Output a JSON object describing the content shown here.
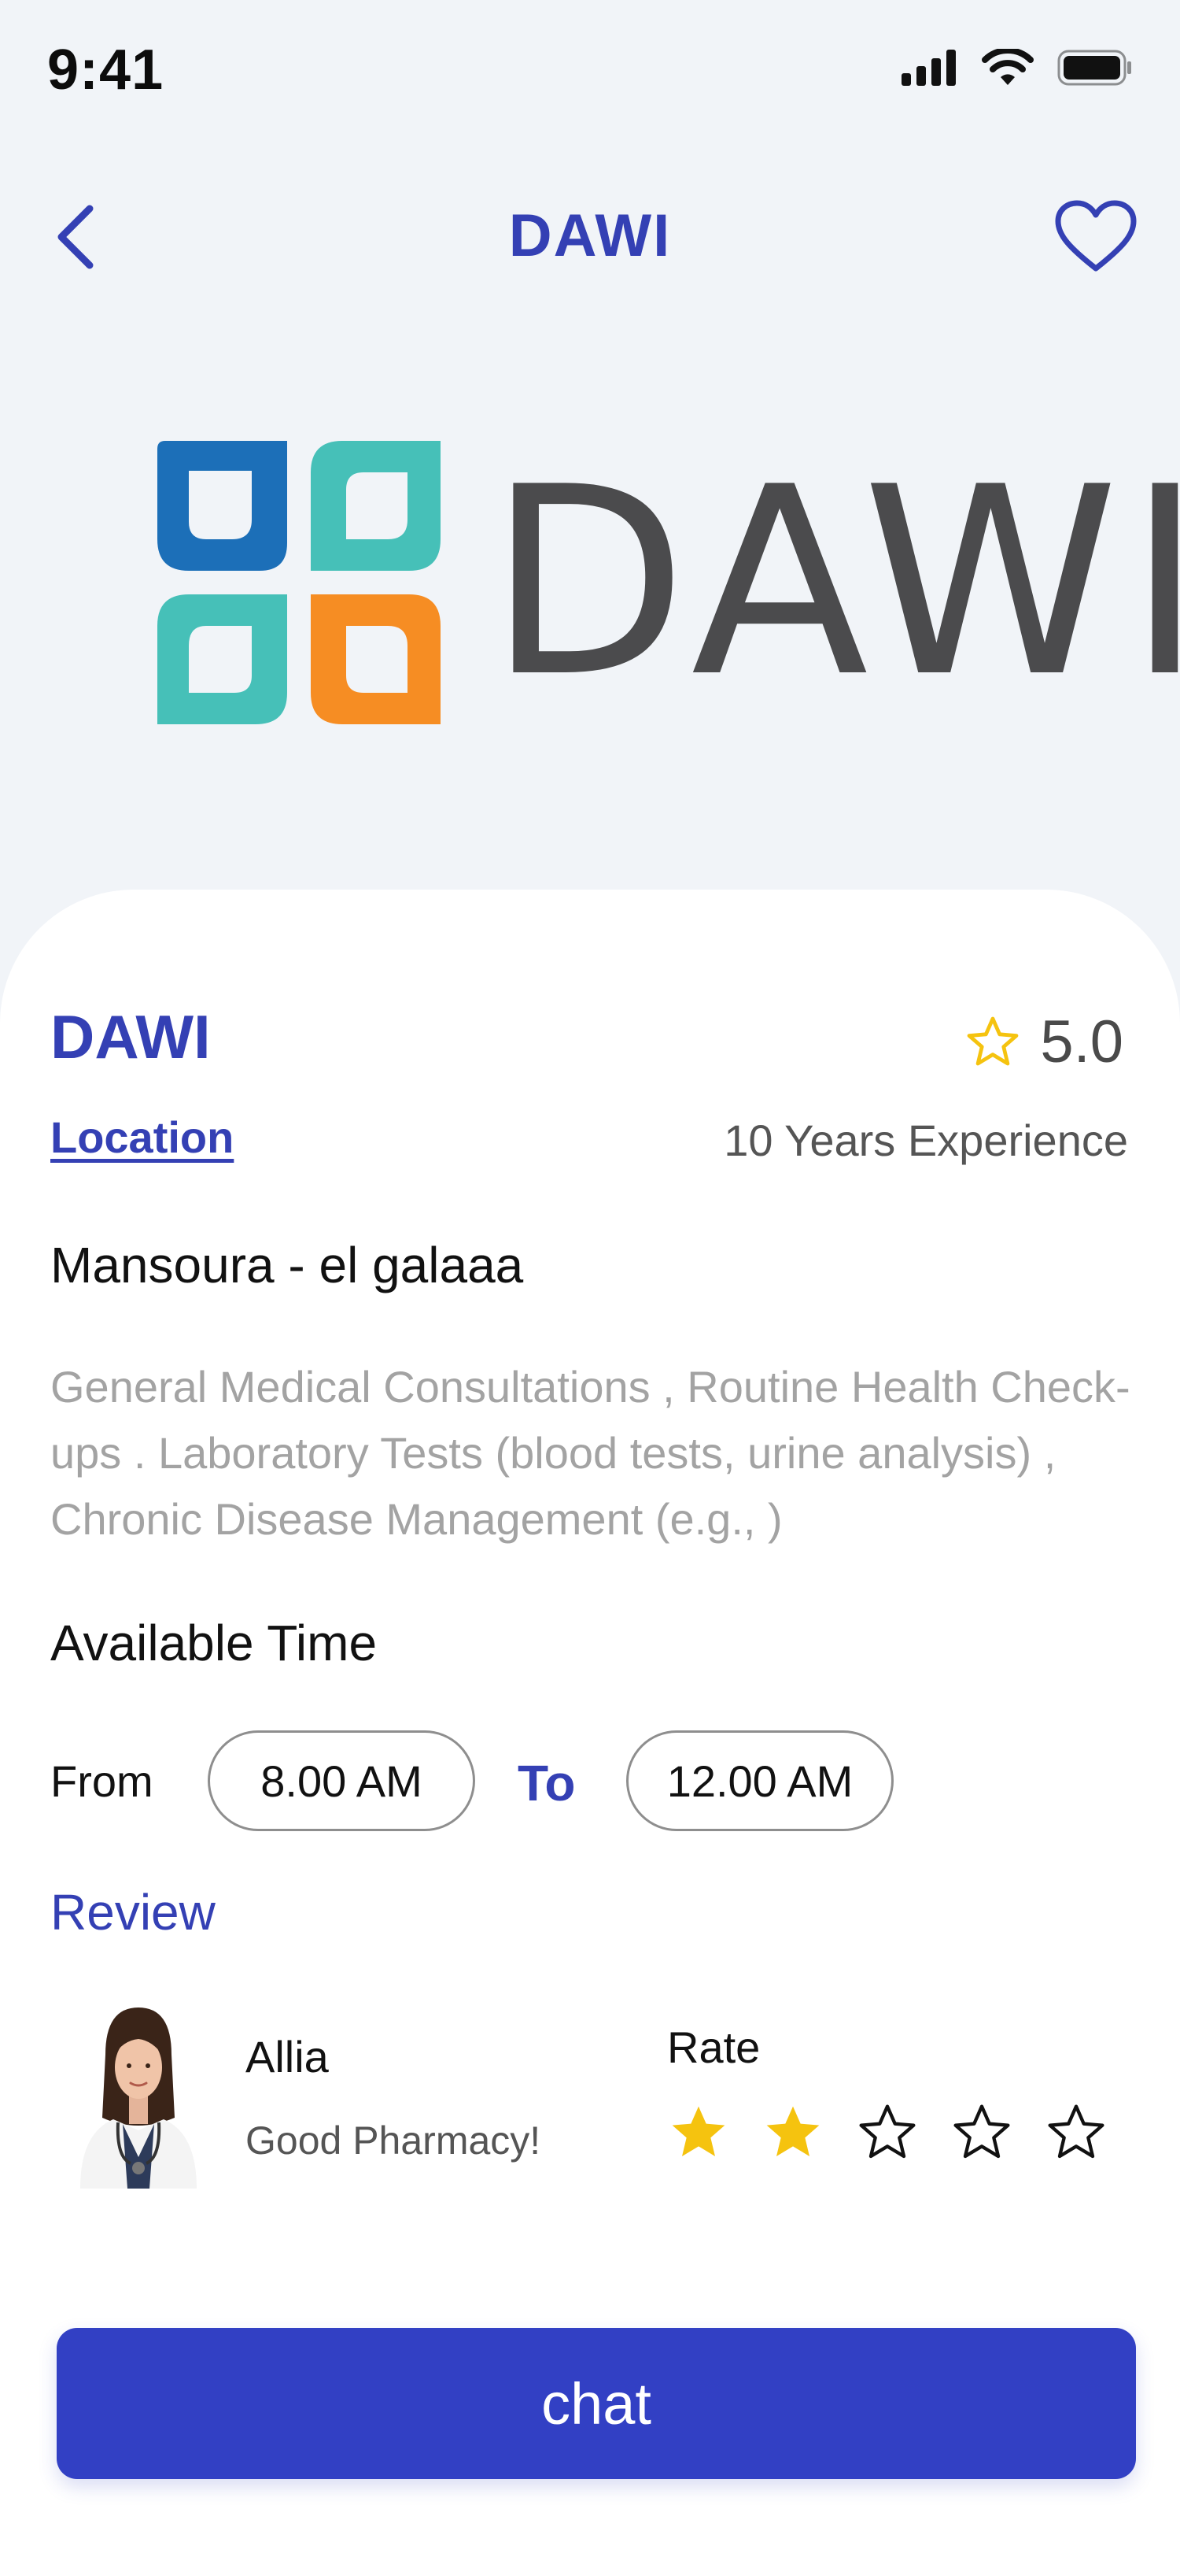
{
  "status_bar": {
    "time": "9:41"
  },
  "header": {
    "title": "DAWI"
  },
  "logo": {
    "wordmark": "DAWI"
  },
  "pharmacy": {
    "name": "DAWI",
    "rating": "5.0",
    "location_label": "Location",
    "experience": "10 Years Experience",
    "address": "Mansoura - el galaaa",
    "description": "General Medical Consultations , Routine Health Check-ups . Laboratory Tests (blood tests, urine analysis) , Chronic Disease Management (e.g., )"
  },
  "availability": {
    "title": "Available Time",
    "from_label": "From",
    "from_time": "8.00 AM",
    "to_label": "To",
    "to_time": "12.00 AM"
  },
  "review": {
    "title": "Review",
    "items": [
      {
        "name": "Allia",
        "text": "Good Pharmacy!",
        "rate_label": "Rate",
        "stars": 2,
        "max_stars": 5
      }
    ]
  },
  "chat_button": {
    "label": "chat"
  },
  "colors": {
    "brand": "#3440b4",
    "button": "#3240c4",
    "star_filled": "#f5c30f",
    "background": "#f1f4f8",
    "logo_blue": "#1c6fb8",
    "logo_teal": "#46c0b8",
    "logo_orange": "#f68d23",
    "logo_gray": "#4b4b4d"
  },
  "icons": [
    "signal-icon",
    "wifi-icon",
    "battery-icon",
    "back-arrow-icon",
    "heart-icon",
    "star-outline-icon",
    "star-filled-icon"
  ]
}
